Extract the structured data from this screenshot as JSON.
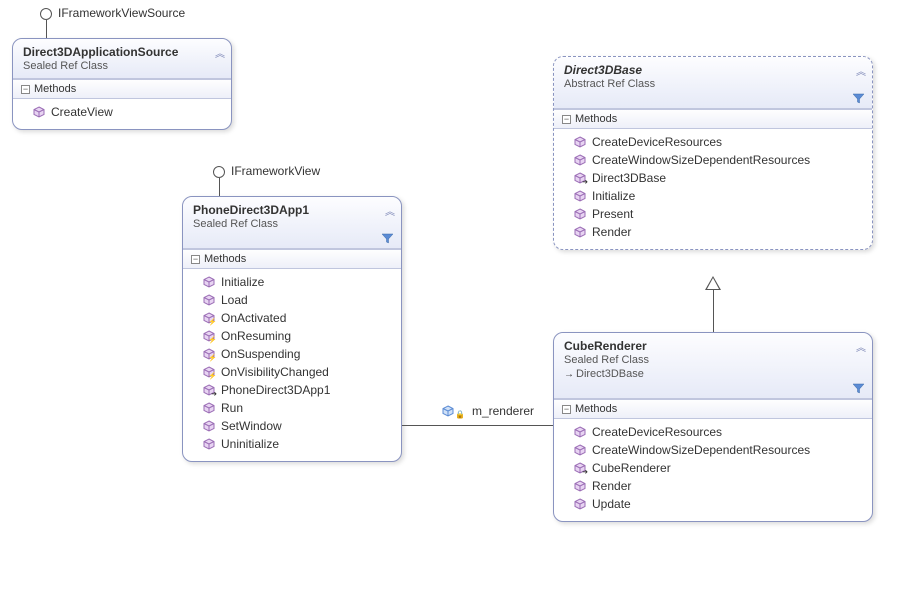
{
  "interfaces": {
    "frameViewSource": "IFrameworkViewSource",
    "frameView": "IFrameworkView"
  },
  "classes": {
    "d3dAppSource": {
      "name": "Direct3DApplicationSource",
      "stereotype": "Sealed Ref Class",
      "section": "Methods",
      "methods": [
        "CreateView"
      ]
    },
    "phoneApp": {
      "name": "PhoneDirect3DApp1",
      "stereotype": "Sealed Ref Class",
      "section": "Methods",
      "methods": [
        "Initialize",
        "Load",
        "OnActivated",
        "OnResuming",
        "OnSuspending",
        "OnVisibilityChanged",
        "PhoneDirect3DApp1",
        "Run",
        "SetWindow",
        "Uninitialize"
      ],
      "badges": {
        "OnActivated": "bolt",
        "OnResuming": "bolt",
        "OnSuspending": "bolt",
        "OnVisibilityChanged": "bolt",
        "PhoneDirect3DApp1": "arrow"
      }
    },
    "d3dBase": {
      "name": "Direct3DBase",
      "stereotype": "Abstract Ref Class",
      "section": "Methods",
      "methods": [
        "CreateDeviceResources",
        "CreateWindowSizeDependentResources",
        "Direct3DBase",
        "Initialize",
        "Present",
        "Render"
      ],
      "badges": {
        "Direct3DBase": "arrow"
      }
    },
    "cubeRenderer": {
      "name": "CubeRenderer",
      "stereotype": "Sealed Ref Class",
      "baseClass": "Direct3DBase",
      "section": "Methods",
      "methods": [
        "CreateDeviceResources",
        "CreateWindowSizeDependentResources",
        "CubeRenderer",
        "Render",
        "Update"
      ],
      "badges": {
        "CubeRenderer": "arrow"
      }
    }
  },
  "association": {
    "label": "m_renderer"
  },
  "icons": {
    "chevrons": "︽",
    "minus": "−",
    "baseArrow": "→"
  }
}
